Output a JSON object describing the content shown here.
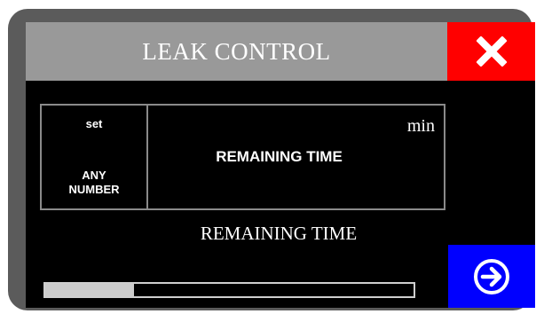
{
  "title": "LEAK CONTROL",
  "panel": {
    "set_label": "set",
    "value_label_line1": "ANY",
    "value_label_line2": "NUMBER",
    "center_label": "REMAINING TIME",
    "unit": "min"
  },
  "remaining_label": "REMAINING TIME",
  "progress": {
    "fraction": 0.24
  },
  "icons": {
    "close": "close-icon",
    "next": "arrow-right-circle-icon"
  },
  "colors": {
    "title_bar": "#999999",
    "close_button": "#ff0000",
    "next_button": "#0000ff",
    "screen_background": "#000000",
    "frame": "#5b5b5b",
    "progress_fill": "#cccccc"
  }
}
